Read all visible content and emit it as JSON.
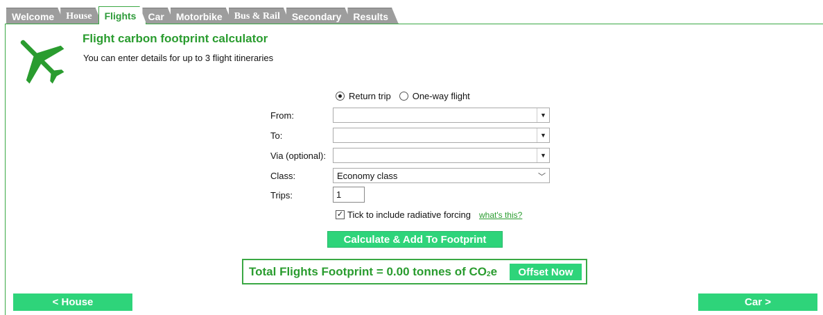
{
  "tabs": [
    {
      "label": "Welcome",
      "active": false
    },
    {
      "label": "House",
      "active": false
    },
    {
      "label": "Flights",
      "active": true
    },
    {
      "label": "Car",
      "active": false
    },
    {
      "label": "Motorbike",
      "active": false
    },
    {
      "label": "Bus & Rail",
      "active": false
    },
    {
      "label": "Secondary",
      "active": false
    },
    {
      "label": "Results",
      "active": false
    }
  ],
  "header": {
    "title": "Flight carbon footprint calculator",
    "subtitle": "You can enter details for up to 3 flight itineraries",
    "icon": "airplane-icon",
    "icon_color": "#2a9c2f"
  },
  "form": {
    "trip_type": {
      "return_label": "Return trip",
      "oneway_label": "One-way flight",
      "selected": "return"
    },
    "from_label": "From:",
    "from_value": "",
    "to_label": "To:",
    "to_value": "",
    "via_label": "Via (optional):",
    "via_value": "",
    "class_label": "Class:",
    "class_value": "Economy class",
    "trips_label": "Trips:",
    "trips_value": "1",
    "rf_label": "Tick to include radiative forcing",
    "rf_checked": true,
    "rf_link": "what's this?",
    "calculate_label": "Calculate & Add To Footprint"
  },
  "total": {
    "prefix": "Total Flights Footprint = 0.00 tonnes of CO",
    "sub": "2",
    "suffix": "e",
    "offset_label": "Offset Now"
  },
  "nav": {
    "prev_label": "< House",
    "next_label": "Car >"
  },
  "colors": {
    "accent": "#2a9c2f",
    "button": "#2ed47a",
    "tab_inactive": "#9d9d9d"
  }
}
